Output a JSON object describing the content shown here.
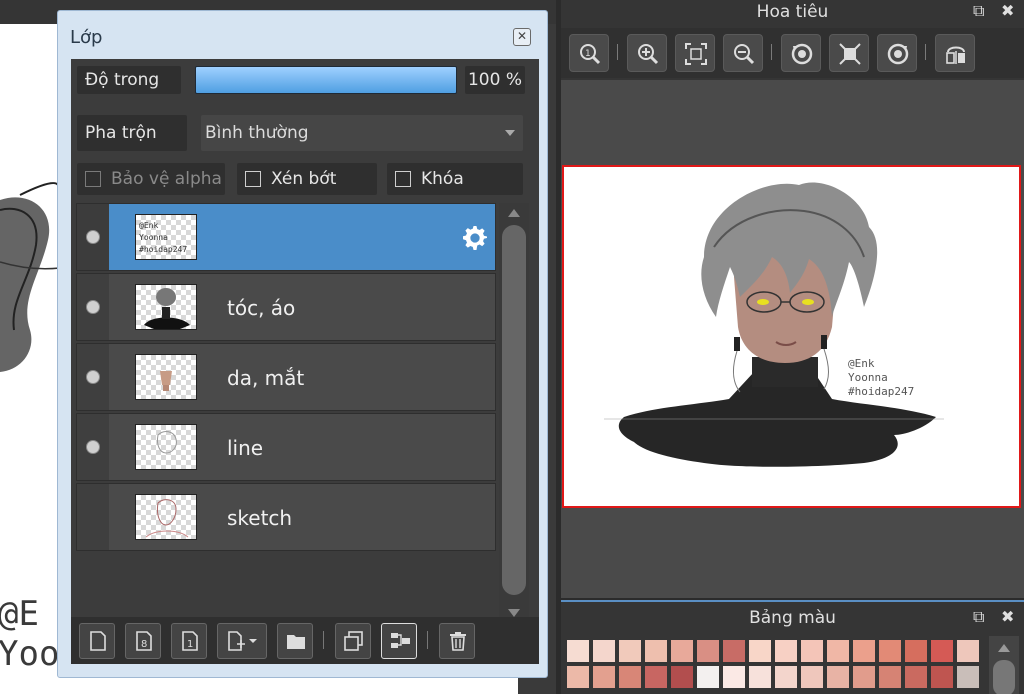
{
  "layer_panel": {
    "title": "Lớp",
    "opacity_label": "Độ trong",
    "opacity_value": "100 %",
    "opacity_fraction": 1.0,
    "blend_label": "Pha trộn",
    "blend_value": "Bình thường",
    "protect_alpha": "Bảo vệ alpha",
    "clipping": "Xén bớt",
    "lock": "Khóa",
    "layers": [
      {
        "name": "",
        "selected": true,
        "visible": true
      },
      {
        "name": "tóc, áo",
        "selected": false,
        "visible": true
      },
      {
        "name": "da, mắt",
        "selected": false,
        "visible": true
      },
      {
        "name": "line",
        "selected": false,
        "visible": true
      },
      {
        "name": "sketch",
        "selected": false,
        "visible": false
      }
    ],
    "toolbar_icons": [
      "new-layer-icon",
      "new-8bit-layer-icon",
      "new-1bit-layer-icon",
      "add-layer-menu-icon",
      "folder-icon",
      "duplicate-icon",
      "merge-down-icon",
      "trash-icon"
    ]
  },
  "navigator": {
    "title": "Hoa tiêu",
    "toolbar_icons": [
      "zoom-fit-icon",
      "zoom-in-icon",
      "fit-screen-icon",
      "zoom-out-icon",
      "rotate-left-icon",
      "reset-view-icon",
      "rotate-right-icon",
      "flip-horizontal-icon"
    ],
    "watermark": "@Enk\nYoonna\n#hoidap247"
  },
  "canvas": {
    "watermark": "@E\nYoo"
  },
  "color_panel": {
    "title": "Bảng màu",
    "swatches_row1": [
      "#f6dcd2",
      "#f4d6cc",
      "#f1cabb",
      "#eebfae",
      "#e8a99a",
      "#d98f84",
      "#c86c66",
      "#f8d6c8",
      "#f7d0c4",
      "#f4c5b8",
      "#f0b7a6",
      "#eba08c",
      "#e28a76",
      "#d66e5e",
      "#d55a55",
      "#eec7bb"
    ],
    "swatches_row2": [
      "#ecb9a8",
      "#e3a08f",
      "#d88677",
      "#c86662",
      "#b24e4e",
      "#f3f0ef",
      "#fbe9e5",
      "#f7e1db",
      "#f3d5cc",
      "#efc7bc",
      "#e8b3a5",
      "#e19c8c",
      "#d68374",
      "#ca6a60",
      "#bf5550",
      "#c9beb9"
    ]
  },
  "accent_colors": {
    "selected_layer": "#4a8dc9",
    "navigator_frame": "#e01818",
    "opacity_bar": "#6fb3f0"
  }
}
